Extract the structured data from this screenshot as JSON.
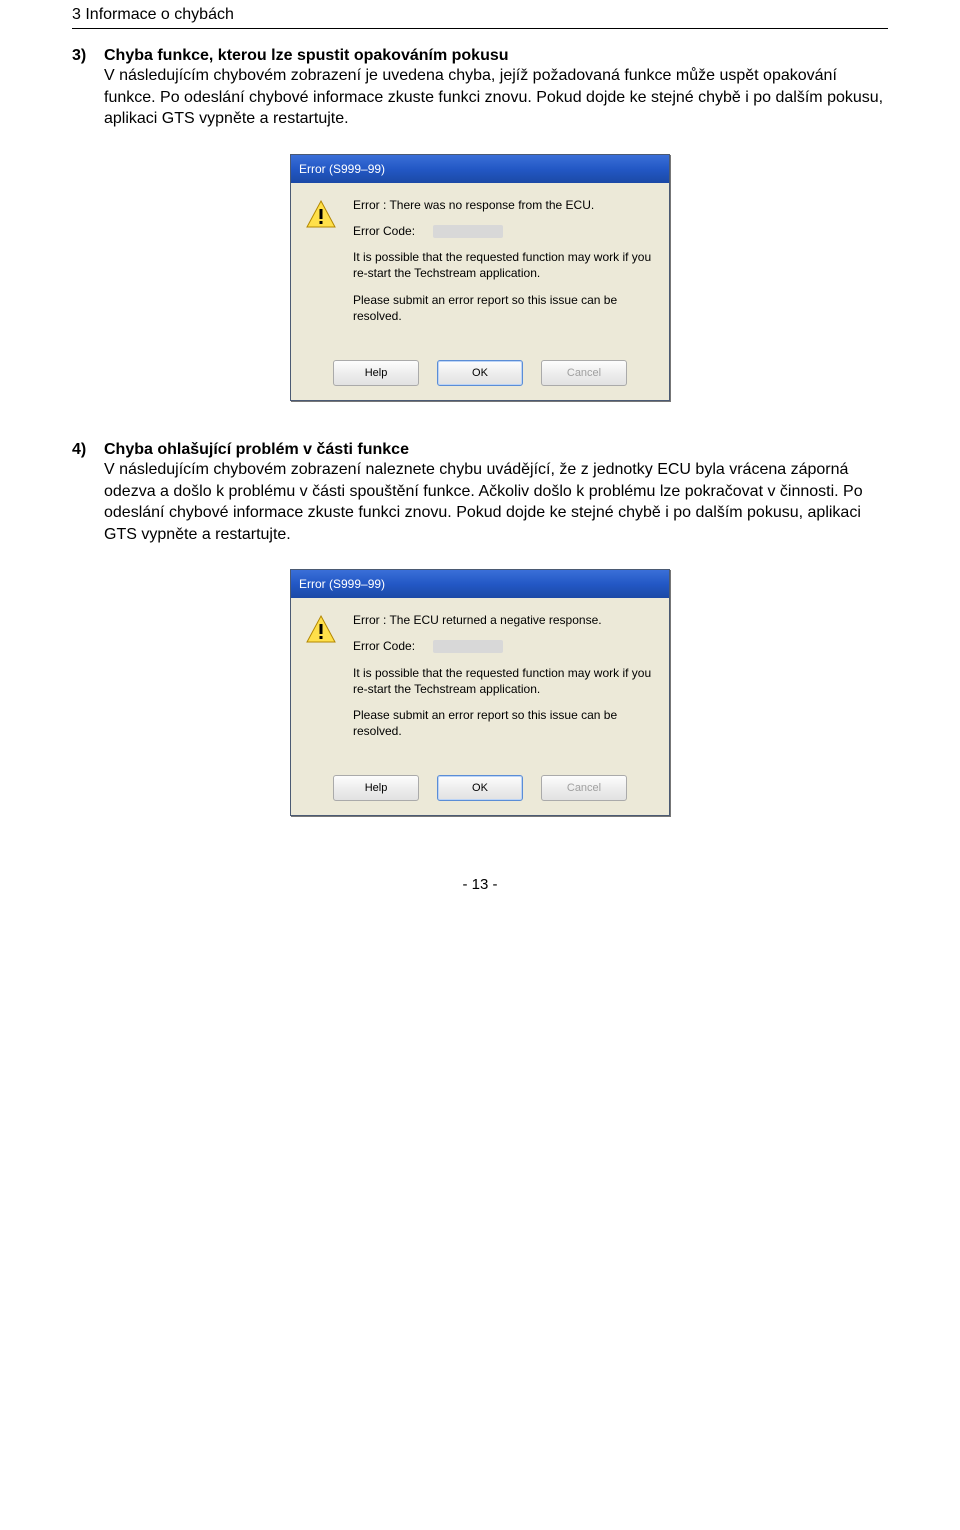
{
  "header": "3 Informace o chybách",
  "items": [
    {
      "num": "3)",
      "title": "Chyba funkce, kterou lze spustit opakováním pokusu",
      "body": "V následujícím chybovém zobrazení je uvedena chyba, jejíž požadovaná funkce může uspět opakování funkce. Po odeslání chybové informace zkuste funkci znovu. Pokud dojde ke stejné chybě i po dalším pokusu, aplikaci GTS vypněte a restartujte."
    },
    {
      "num": "4)",
      "title": "Chyba ohlašující problém v části funkce",
      "body": "V následujícím chybovém zobrazení naleznete chybu uvádějící, že z jednotky ECU byla vrácena záporná odezva a došlo k problému v části spouštění funkce. Ačkoliv došlo k problému lze pokračovat v činnosti. Po odeslání chybové informace zkuste funkci znovu. Pokud dojde ke stejné chybě i po dalším pokusu, aplikaci GTS vypněte a restartujte."
    }
  ],
  "dialogs": [
    {
      "title": "Error (S999–99)",
      "line1": "Error : There was no response from the ECU.",
      "codeLabel": "Error Code:",
      "line2": "It is possible that the requested function may work if you re-start the Techstream application.",
      "line3": "Please submit an error report so this issue can be resolved.",
      "buttons": {
        "help": "Help",
        "ok": "OK",
        "cancel": "Cancel"
      }
    },
    {
      "title": "Error (S999–99)",
      "line1": "Error : The ECU returned a negative response.",
      "codeLabel": "Error Code:",
      "line2": "It is possible that the requested function may work if you re-start the Techstream application.",
      "line3": "Please submit an error report so this issue can be resolved.",
      "buttons": {
        "help": "Help",
        "ok": "OK",
        "cancel": "Cancel"
      }
    }
  ],
  "pageNumber": "- 13 -"
}
